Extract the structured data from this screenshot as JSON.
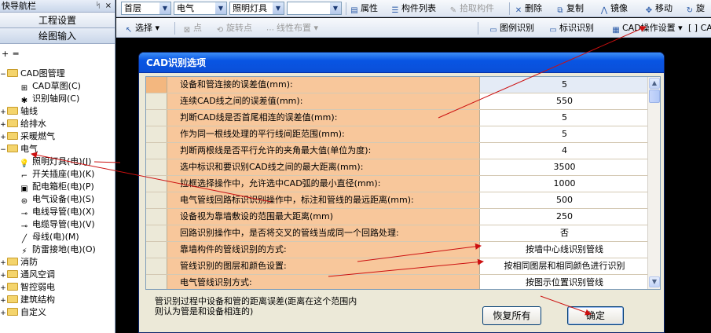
{
  "left_panel": {
    "title": "快导航栏",
    "pin": "ᛋ",
    "close": "×",
    "buttons": [
      "工程设置",
      "绘图输入"
    ],
    "toolbar_glyphs": "+ ═",
    "tree": [
      {
        "label": "CAD图管理",
        "exp": "−",
        "children": [
          {
            "label": "CAD草图(C)",
            "icon": "cad-sketch-icon",
            "glyph": "⊞"
          },
          {
            "label": "识别轴网(C)",
            "icon": "gear-icon",
            "glyph": "✱"
          }
        ]
      },
      {
        "label": "轴线",
        "exp": "+"
      },
      {
        "label": "给排水",
        "exp": "+"
      },
      {
        "label": "采暖燃气",
        "exp": "+"
      },
      {
        "label": "电气",
        "exp": "−",
        "children": [
          {
            "label": "照明灯具(电)(J)",
            "icon": "light-bulb-icon",
            "glyph": "💡"
          },
          {
            "label": "开关插座(电)(K)",
            "icon": "switch-icon",
            "glyph": "⌐"
          },
          {
            "label": "配电箱柜(电)(P)",
            "icon": "distribution-box-icon",
            "glyph": "▣"
          },
          {
            "label": "电气设备(电)(S)",
            "icon": "electrical-device-icon",
            "glyph": "⊜"
          },
          {
            "label": "电线导管(电)(X)",
            "icon": "wire-conduit-icon",
            "glyph": "⊸"
          },
          {
            "label": "电缆导管(电)(V)",
            "icon": "cable-conduit-icon",
            "glyph": "⊸"
          },
          {
            "label": "母线(电)(M)",
            "icon": "busbar-icon",
            "glyph": "╱"
          },
          {
            "label": "防雷接地(电)(O)",
            "icon": "lightning-ground-icon",
            "glyph": "⚡"
          }
        ]
      },
      {
        "label": "消防",
        "exp": "+"
      },
      {
        "label": "通风空调",
        "exp": "+"
      },
      {
        "label": "智控弱电",
        "exp": "+"
      },
      {
        "label": "建筑结构",
        "exp": "+"
      },
      {
        "label": "自定义",
        "exp": "+"
      }
    ]
  },
  "toolbar1": {
    "floor": "首层",
    "discipline": "电气",
    "component": "照明灯具",
    "instance": "",
    "properties": "属性",
    "component_list": "构件列表",
    "pick_component": "拾取构件",
    "delete": "删除",
    "copy": "复制",
    "mirror": "镜像",
    "move": "移动",
    "rotate": "旋"
  },
  "toolbar2": {
    "select": "选择",
    "point": "点",
    "rotate_point": "旋转点",
    "linear_layout": "线性布置",
    "legend_recognize": "图例识别",
    "mark_recognize": "标识识别",
    "cad_settings": "CAD操作设置",
    "extra": "[ ] CA"
  },
  "dialog": {
    "title": "CAD识别选项",
    "rows": [
      {
        "name": "设备和管连接的误差值(mm):",
        "value": "5"
      },
      {
        "name": "连续CAD线之间的误差值(mm):",
        "value": "550"
      },
      {
        "name": "判断CAD线是否首尾相连的误差值(mm):",
        "value": "5"
      },
      {
        "name": "作为同一根线处理的平行线间距范围(mm):",
        "value": "5"
      },
      {
        "name": "判断两根线是否平行允许的夹角最大值(单位为度):",
        "value": "4"
      },
      {
        "name": "选中标识和要识别CAD线之间的最大距离(mm):",
        "value": "3500"
      },
      {
        "name": "拉框选择操作中，允许选中CAD弧的最小直径(mm):",
        "value": "1000"
      },
      {
        "name": "电气管线回路标识识别操作中，标注和管线的最远距离(mm):",
        "value": "500"
      },
      {
        "name": "设备视为靠墙敷设的范围最大距离(mm)",
        "value": "250"
      },
      {
        "name": "回路识别操作中，是否将交叉的管线当成同一个回路处理:",
        "value": "否"
      },
      {
        "name": "靠墙构件的管线识别的方式:",
        "value": "按墙中心线识别管线"
      },
      {
        "name": "管线识别的图层和颜色设置:",
        "value": "按相同图层和相同颜色进行识别"
      },
      {
        "name": "电气管线识别方式:",
        "value": "按图示位置识别管线"
      }
    ],
    "description": "管识别过程中设备和管的距离误差(距离在这个范围内则认为管是和设备相连的)",
    "restore_all": "恢复所有",
    "ok": "确定"
  },
  "colors": {
    "name_cell_bg": "#f8c79b",
    "title_bar": "#0a4fd8",
    "annotation_arrows": "#cc1010",
    "background": "#000000"
  }
}
